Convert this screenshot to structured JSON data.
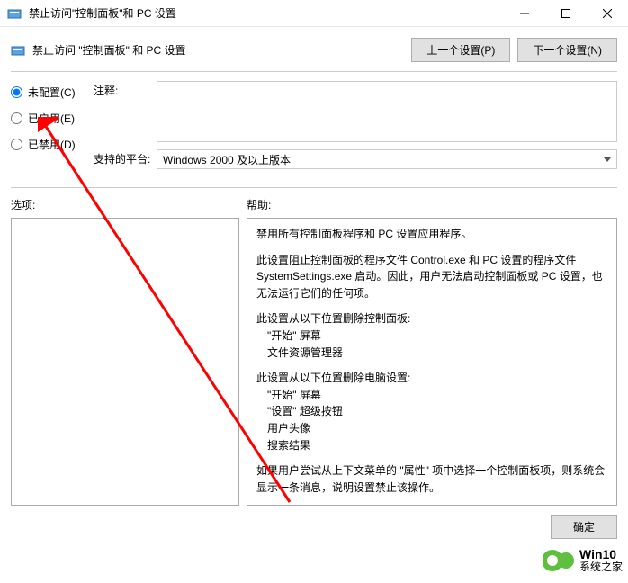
{
  "title": "禁止访问\"控制面板\"和 PC 设置",
  "header": {
    "policy_name": "禁止访问 \"控制面板\" 和 PC 设置",
    "prev_btn": "上一个设置(P)",
    "next_btn": "下一个设置(N)"
  },
  "radios": {
    "not_configured": "未配置(C)",
    "enabled": "已启用(E)",
    "disabled": "已禁用(D)"
  },
  "labels": {
    "comment": "注释:",
    "supported": "支持的平台:",
    "options": "选项:",
    "help": "帮助:"
  },
  "supported_value": "Windows 2000 及以上版本",
  "help": {
    "p1": "禁用所有控制面板程序和 PC 设置应用程序。",
    "p2": "此设置阻止控制面板的程序文件 Control.exe 和 PC 设置的程序文件 SystemSettings.exe 启动。因此，用户无法启动控制面板或 PC 设置，也无法运行它们的任何项。",
    "p3a": "此设置从以下位置删除控制面板:",
    "p3b": "\"开始\" 屏幕",
    "p3c": "文件资源管理器",
    "p4a": "此设置从以下位置删除电脑设置:",
    "p4b": "\"开始\" 屏幕",
    "p4c": "\"设置\" 超级按钮",
    "p4d": "用户头像",
    "p4e": "搜索结果",
    "p5": "如果用户尝试从上下文菜单的 \"属性\" 项中选择一个控制面板项，则系统会显示一条消息，说明设置禁止该操作。"
  },
  "footer": {
    "ok": "确定"
  },
  "watermark": {
    "t1": "Win10",
    "t2": "系统之家"
  }
}
